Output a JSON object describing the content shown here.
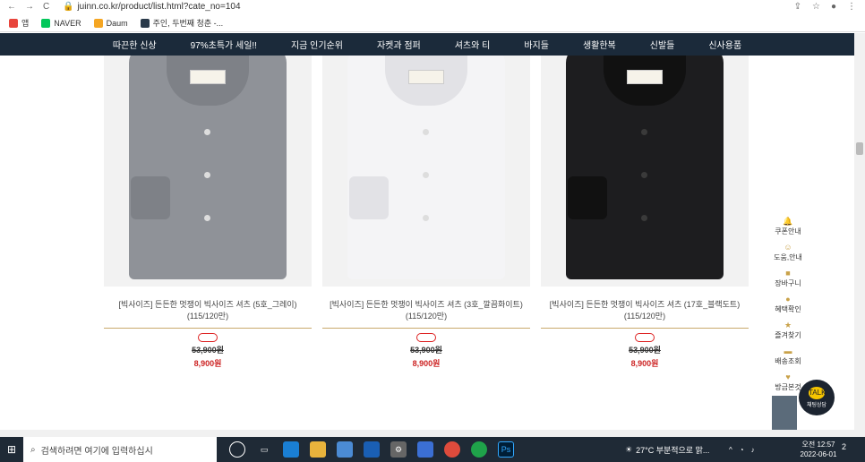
{
  "browser": {
    "url": "juinn.co.kr/product/list.html?cate_no=104",
    "back": "←",
    "forward": "→",
    "reload": "C",
    "bookmarks": [
      {
        "label": "앱",
        "color": "#e8453c"
      },
      {
        "label": "NAVER",
        "color": "#03c75a"
      },
      {
        "label": "Daum",
        "color": "#f5a623"
      },
      {
        "label": "주인, 두번째 청춘 -...",
        "color": "#2a3a4a"
      }
    ]
  },
  "nav": {
    "items": [
      "따끈한 신상",
      "97%초특가 세일!!",
      "지금 인기순위",
      "자켓과 점퍼",
      "셔츠와 티",
      "바지들",
      "생활한복",
      "신발들",
      "신사용품"
    ]
  },
  "products": [
    {
      "title": "[빅사이즈] 든든한 멋쟁이 빅사이즈 셔츠 (5호_그레이)",
      "size": "(115/120만)",
      "old_price": "53,900원",
      "new_price": "8,900원",
      "shirt_color": "#8f9298",
      "collar_color": "#7e8187"
    },
    {
      "title": "[빅사이즈] 든든한 멋쟁이 빅사이즈 셔츠 (3호_깔끔화이트)",
      "size": "(115/120만)",
      "old_price": "53,900원",
      "new_price": "8,900원",
      "shirt_color": "#f4f4f6",
      "collar_color": "#e2e2e6"
    },
    {
      "title": "[빅사이즈] 든든한 멋쟁이 빅사이즈 셔츠 (17호_블랙도트)",
      "size": "(115/120만)",
      "old_price": "53,900원",
      "new_price": "8,900원",
      "shirt_color": "#1d1d1f",
      "collar_color": "#111"
    }
  ],
  "sidebar": {
    "items": [
      {
        "label": "쿠폰안내",
        "icon": "bell-icon",
        "sym": "🔔"
      },
      {
        "label": "도움,안내",
        "icon": "smile-icon",
        "sym": "☺"
      },
      {
        "label": "장바구니",
        "icon": "bag-icon",
        "sym": "■"
      },
      {
        "label": "혜택확인",
        "icon": "gift-icon",
        "sym": "●"
      },
      {
        "label": "즐겨찾기",
        "icon": "star-icon",
        "sym": "★"
      },
      {
        "label": "배송조회",
        "icon": "truck-icon",
        "sym": "▬"
      },
      {
        "label": "방금본것",
        "icon": "heart-icon",
        "sym": "♥"
      }
    ],
    "chat_label": "채팅상담",
    "chat_bubble": "TALK"
  },
  "taskbar": {
    "search_placeholder": "검색하려면 여기에 입력하십시",
    "weather": "27°C  부분적으로 맑...",
    "time": "오전 12:57",
    "date": "2022-06-01",
    "notif": "2"
  }
}
